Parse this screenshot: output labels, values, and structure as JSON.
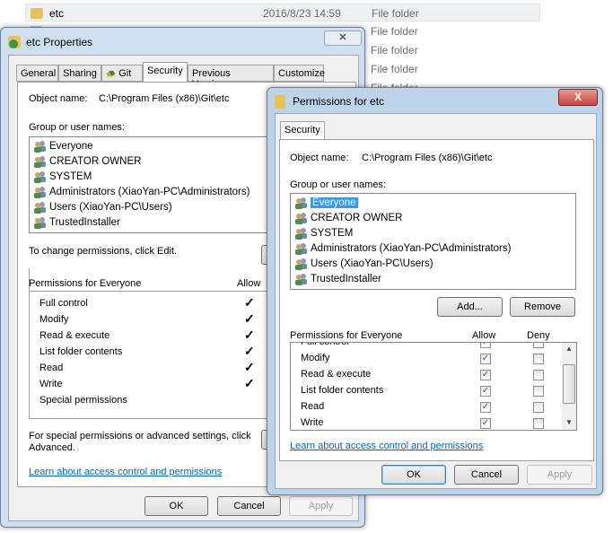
{
  "explorer": {
    "rows": [
      {
        "name": "etc",
        "date": "2016/8/23 14:59",
        "type": "File folder",
        "selected": true
      },
      {
        "name": "",
        "date": "",
        "type": "File folder"
      },
      {
        "name": "",
        "date": "",
        "type": "File folder"
      },
      {
        "name": "",
        "date": "",
        "type": "File folder"
      },
      {
        "name": "",
        "date": "",
        "type": "File folder"
      }
    ]
  },
  "props": {
    "title": "etc Properties",
    "tabs": [
      "General",
      "Sharing",
      "Git",
      "Security",
      "Previous Versions",
      "Customize"
    ],
    "active_tab": "Security",
    "object_label": "Object name:",
    "object_value": "C:\\Program Files (x86)\\Git\\etc",
    "group_label": "Group or user names:",
    "users": [
      "Everyone",
      "CREATOR OWNER",
      "SYSTEM",
      "Administrators (XiaoYan-PC\\Administrators)",
      "Users (XiaoYan-PC\\Users)",
      "TrustedInstaller"
    ],
    "edit_hint": "To change permissions, click Edit.",
    "perm_header": "Permissions for Everyone",
    "allow_header": "Allow",
    "perms": [
      {
        "name": "Full control",
        "allow": true
      },
      {
        "name": "Modify",
        "allow": true
      },
      {
        "name": "Read & execute",
        "allow": true
      },
      {
        "name": "List folder contents",
        "allow": true
      },
      {
        "name": "Read",
        "allow": true
      },
      {
        "name": "Write",
        "allow": true
      },
      {
        "name": "Special permissions",
        "allow": false
      }
    ],
    "advanced_hint": "For special permissions or advanced settings, click Advanced.",
    "link": "Learn about access control and permissions",
    "ok": "OK",
    "cancel": "Cancel",
    "apply": "Apply"
  },
  "perm": {
    "title": "Permissions for etc",
    "tab": "Security",
    "object_label": "Object name:",
    "object_value": "C:\\Program Files (x86)\\Git\\etc",
    "group_label": "Group or user names:",
    "users": [
      "Everyone",
      "CREATOR OWNER",
      "SYSTEM",
      "Administrators (XiaoYan-PC\\Administrators)",
      "Users (XiaoYan-PC\\Users)",
      "TrustedInstaller"
    ],
    "selected_user": "Everyone",
    "add": "Add...",
    "remove": "Remove",
    "perm_header": "Permissions for Everyone",
    "allow_header": "Allow",
    "deny_header": "Deny",
    "perms": [
      {
        "name": "Full control",
        "allow": true,
        "deny": false
      },
      {
        "name": "Modify",
        "allow": true,
        "deny": false
      },
      {
        "name": "Read & execute",
        "allow": true,
        "deny": false
      },
      {
        "name": "List folder contents",
        "allow": true,
        "deny": false
      },
      {
        "name": "Read",
        "allow": true,
        "deny": false
      },
      {
        "name": "Write",
        "allow": true,
        "deny": false
      }
    ],
    "link": "Learn about access control and permissions",
    "ok": "OK",
    "cancel": "Cancel",
    "apply": "Apply"
  },
  "colors": {
    "selection": "#3399ff",
    "link": "#0066cc",
    "close_red": "#c9463d"
  }
}
